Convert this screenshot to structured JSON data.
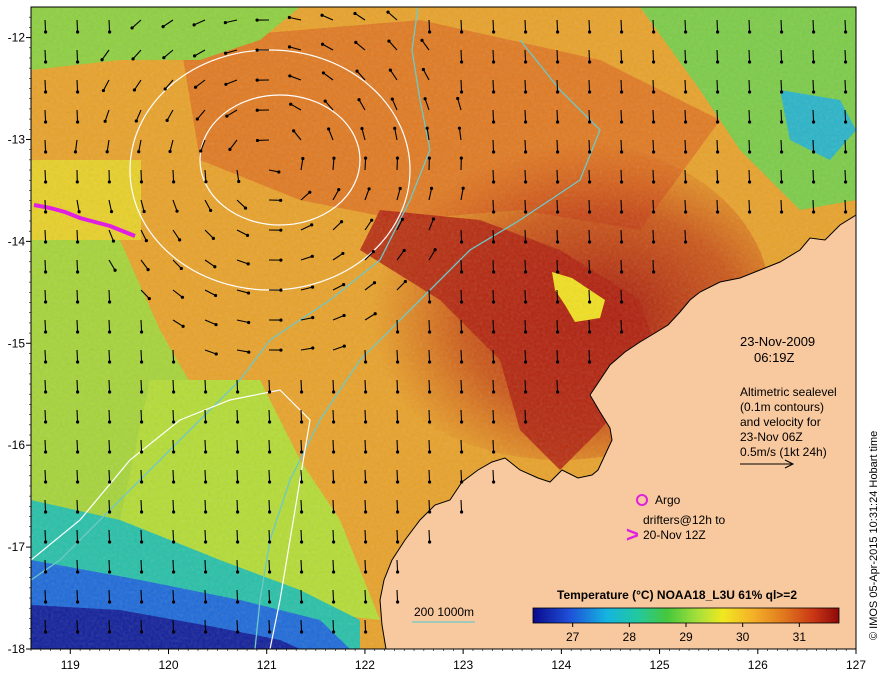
{
  "chart_data": {
    "type": "heatmap",
    "x_ticks": [
      "119",
      "120",
      "121",
      "122",
      "123",
      "124",
      "125",
      "126",
      "127"
    ],
    "x_values": [
      119,
      120,
      121,
      122,
      123,
      124,
      125,
      126,
      127
    ],
    "y_ticks": [
      "-12",
      "-13",
      "-14",
      "-15",
      "-16",
      "-17",
      "-18"
    ],
    "y_values": [
      -12,
      -13,
      -14,
      -15,
      -16,
      -17,
      -18
    ],
    "xlim": [
      118.6,
      127
    ],
    "ylim": [
      -18,
      -11.7
    ],
    "colorbar": {
      "title": "Temperature (°C) NOAA18_L3U 61% ql>=2",
      "ticks": [
        "27",
        "28",
        "29",
        "30",
        "31"
      ],
      "tick_values": [
        27,
        28,
        29,
        30,
        31
      ],
      "range": [
        26.3,
        31.7
      ]
    },
    "date_label": "23-Nov-2009",
    "time_label": "06:19Z",
    "altimetry_text": [
      "Altimetric sealevel",
      "(0.1m contours)",
      "and velocity for",
      "23-Nov 06Z",
      "0.5m/s (1kt 24h)"
    ],
    "argo_label": "Argo",
    "drifters_text": [
      "drifters@12h to",
      "20-Nov 12Z"
    ],
    "drifter_symbol": ">",
    "isobath_label": "200  1000m",
    "credit": "© IMOS 05-Apr-2015 10:31:24 Hobart time",
    "colors": {
      "land": "#f8c89e",
      "coast": "#000000",
      "isobath": "#6fc8c8",
      "sealevel_contour": "#ffffff",
      "argo": "#e020e0",
      "drifter": "#e020e0",
      "arrow": "#000000"
    }
  }
}
